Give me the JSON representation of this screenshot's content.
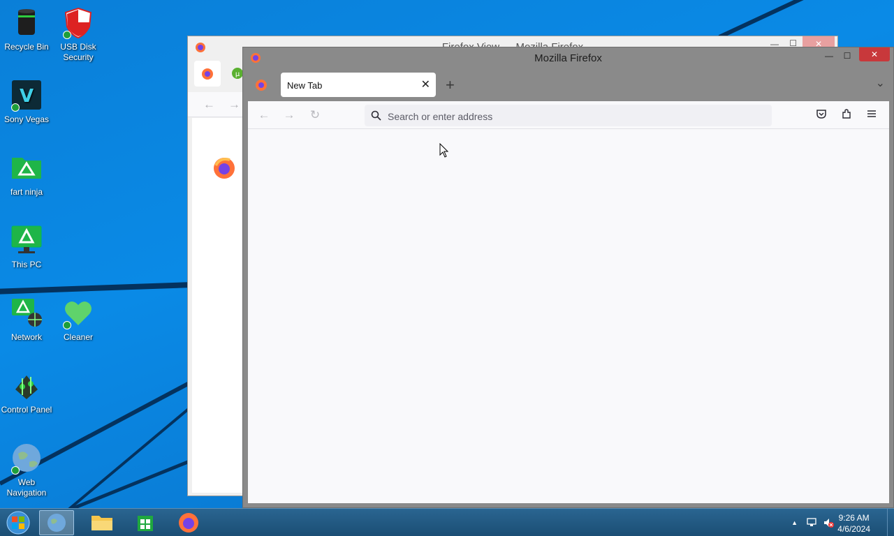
{
  "desktop": {
    "icons": [
      {
        "label": "Recycle Bin"
      },
      {
        "label": "USB Disk Security"
      },
      {
        "label": "Sony Vegas"
      },
      {
        "label": "fart ninja"
      },
      {
        "label": "This PC"
      },
      {
        "label": "Network"
      },
      {
        "label": "Cleaner"
      },
      {
        "label": "Control Panel"
      },
      {
        "label": "Web Navigation"
      }
    ]
  },
  "back_window": {
    "title": "Firefox View — Mozilla Firefox",
    "close": "✕"
  },
  "front_window": {
    "title": "Mozilla Firefox",
    "minimize": "—",
    "maximize": "☐",
    "close": "✕",
    "tab_label": "New Tab",
    "tab_close": "✕",
    "new_tab": "+",
    "tab_list": "⌄",
    "back": "←",
    "forward": "→",
    "reload": "↻",
    "search_placeholder": "Search or enter address"
  },
  "taskbar": {
    "time": "9:26 AM",
    "date": "4/6/2024",
    "tray_arrow": "▲"
  },
  "colors": {
    "desktop_blue": "#0a7fd8",
    "firefox_orange": "#ff7139",
    "close_red": "#c8383b"
  }
}
